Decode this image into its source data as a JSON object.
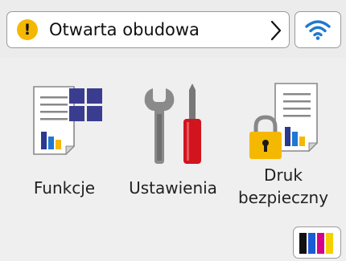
{
  "status_bar": {
    "message": "Otwarta obudowa",
    "warning_symbol": "!",
    "warning_color": "#f5b800"
  },
  "tiles": [
    {
      "label": "Funkcje",
      "icon": "functions-icon"
    },
    {
      "label": "Ustawienia",
      "icon": "settings-tools-icon"
    },
    {
      "label_line1": "Druk",
      "label_line2": "bezpieczny",
      "icon": "secure-print-icon"
    }
  ],
  "ink": {
    "icon": "ink-cartridges-icon",
    "colors": [
      "#111111",
      "#1a5bd6",
      "#d6008a",
      "#f5d000"
    ]
  },
  "colors": {
    "accent_blue": "#2a3a8f",
    "wifi_blue": "#1f78d1",
    "lock_yellow": "#f5b800",
    "tool_red": "#d2141e"
  }
}
